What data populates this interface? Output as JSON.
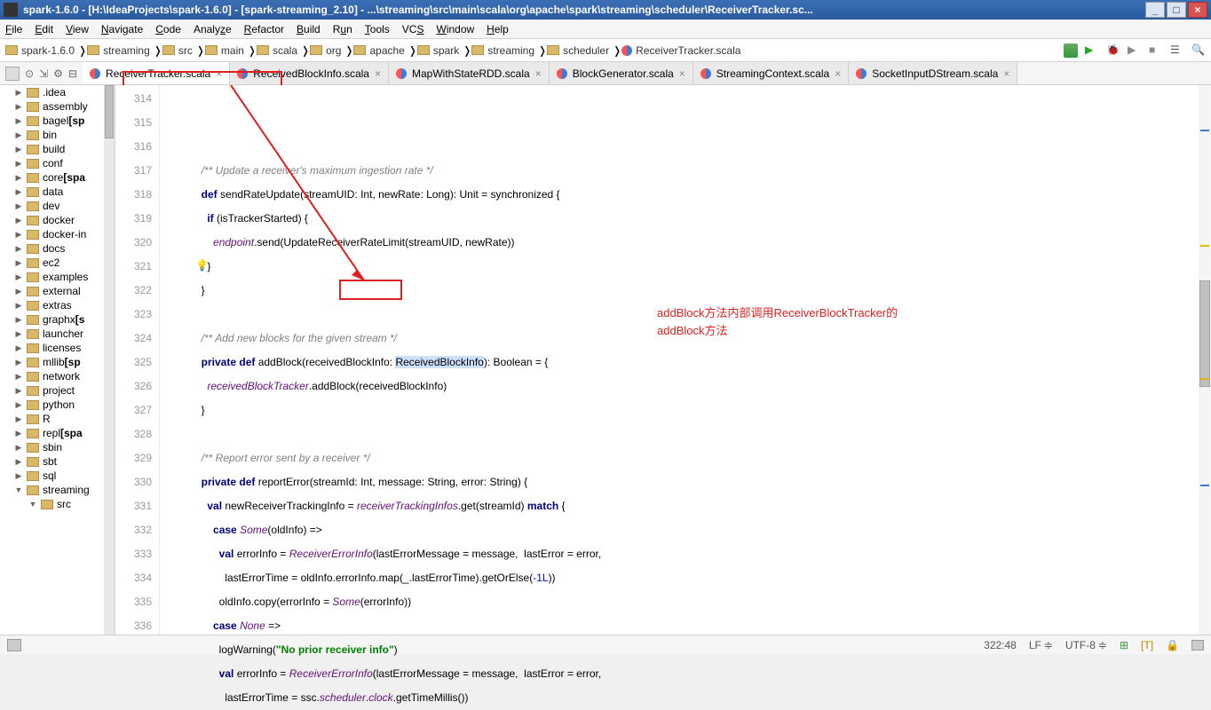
{
  "title": "spark-1.6.0 - [H:\\IdeaProjects\\spark-1.6.0] - [spark-streaming_2.10] - ...\\streaming\\src\\main\\scala\\org\\apache\\spark\\streaming\\scheduler\\ReceiverTracker.sc...",
  "menu": {
    "file": "File",
    "edit": "Edit",
    "view": "View",
    "navigate": "Navigate",
    "code": "Code",
    "analyze": "Analyze",
    "refactor": "Refactor",
    "build": "Build",
    "run": "Run",
    "tools": "Tools",
    "vcs": "VCS",
    "window": "Window",
    "help": "Help"
  },
  "breadcrumbs": [
    "spark-1.6.0",
    "streaming",
    "src",
    "main",
    "scala",
    "org",
    "apache",
    "spark",
    "streaming",
    "scheduler",
    "ReceiverTracker.scala"
  ],
  "tabs": [
    {
      "label": "ReceiverTracker.scala",
      "active": true
    },
    {
      "label": "ReceivedBlockInfo.scala",
      "active": false
    },
    {
      "label": "MapWithStateRDD.scala",
      "active": false
    },
    {
      "label": "BlockGenerator.scala",
      "active": false
    },
    {
      "label": "StreamingContext.scala",
      "active": false
    },
    {
      "label": "SocketInputDStream.scala",
      "active": false
    }
  ],
  "tree": [
    {
      "label": ".idea"
    },
    {
      "label": "assembly"
    },
    {
      "label": "bagel",
      "bold": "[sp"
    },
    {
      "label": "bin"
    },
    {
      "label": "build"
    },
    {
      "label": "conf"
    },
    {
      "label": "core",
      "bold": "[spa"
    },
    {
      "label": "data"
    },
    {
      "label": "dev"
    },
    {
      "label": "docker"
    },
    {
      "label": "docker-in"
    },
    {
      "label": "docs"
    },
    {
      "label": "ec2"
    },
    {
      "label": "examples"
    },
    {
      "label": "external"
    },
    {
      "label": "extras"
    },
    {
      "label": "graphx",
      "bold": "[s"
    },
    {
      "label": "launcher"
    },
    {
      "label": "licenses"
    },
    {
      "label": "mllib",
      "bold": "[sp"
    },
    {
      "label": "network"
    },
    {
      "label": "project"
    },
    {
      "label": "python"
    },
    {
      "label": "R"
    },
    {
      "label": "repl",
      "bold": "[spa"
    },
    {
      "label": "sbin"
    },
    {
      "label": "sbt"
    },
    {
      "label": "sql"
    },
    {
      "label": "streaming",
      "expanded": true
    },
    {
      "label": "src",
      "indent": true,
      "expanded": true
    }
  ],
  "lines": {
    "start": 314,
    "end": 336,
    "current": 322,
    "l314": "/** Update a receiver's maximum ingestion rate */",
    "l315_def": "def",
    "l315_name": "sendRateUpdate",
    "l315_rest1": "(streamUID: Int, newRate: Long): Unit = synchronized {",
    "l316_if": "if",
    "l316_rest": " (isTrackerStarted) {",
    "l317_field": "endpoint",
    "l317_rest": ".send(UpdateReceiverRateLimit(streamUID, newRate))",
    "l318": "}",
    "l319": "}",
    "l321": "/** Add new blocks for the given stream */",
    "l322_priv": "private def",
    "l322_name": "addBlock",
    "l322_param": "(receivedBlockInfo: ",
    "l322_type": "ReceivedBlockInfo",
    "l322_rest": "): Boolean = {",
    "l323_field": "receivedBlockTracker",
    "l323_rest": ".addBlock(receivedBlockInfo)",
    "l324": "}",
    "l326": "/** Report error sent by a receiver */",
    "l327_priv": "private def",
    "l327_name": "reportError",
    "l327_rest1": "(streamId: Int, message: ",
    "l327_str": "String",
    "l327_rest2": ", error: ",
    "l327_rest3": ") {",
    "l328_val": "val",
    "l328_rest1": " newReceiverTrackingInfo = ",
    "l328_field": "receiverTrackingInfos",
    "l328_rest2": ".get(streamId) ",
    "l328_match": "match",
    " l328_rest3": " {",
    "l329_case": "case",
    "l329_some": "Some",
    "l329_rest": "(oldInfo) =>",
    "l330_val": "val",
    "l330_rest1": " errorInfo = ",
    "l330_type": "ReceiverErrorInfo",
    "l330_rest2": "(lastErrorMessage = message,  lastError = error,",
    "l331_rest1": "lastErrorTime = oldInfo.errorInfo.map(_.lastErrorTime).getOrElse(",
    "l331_num": "-1L",
    "l331_rest2": "))",
    "l332_rest1": "oldInfo.copy(errorInfo = ",
    "l332_some": "Some",
    "l332_rest2": "(errorInfo))",
    "l333_case": "case",
    "l333_none": "None",
    "l333_rest": " =>",
    "l334_rest1": "logWarning(",
    "l334_str": "\"No prior receiver info\"",
    "l334_rest2": ")",
    "l335_val": "val",
    "l335_rest1": " errorInfo = ",
    "l335_type": "ReceiverErrorInfo",
    "l335_rest2": "(lastErrorMessage = message,  lastError = error,",
    "l336_rest1": "lastErrorTime = ssc.",
    "l336_field1": "scheduler",
    "l336_dot1": ".",
    "l336_field2": "clock",
    "l336_rest2": ".getTimeMillis())"
  },
  "annotation": {
    "line1": "addBlock方法内部调用ReceiverBlockTracker的",
    "line2": "addBlock方法"
  },
  "status": {
    "pos": "322:48",
    "lf": "LF",
    "enc": "UTF-8",
    "lock": "🔒"
  }
}
